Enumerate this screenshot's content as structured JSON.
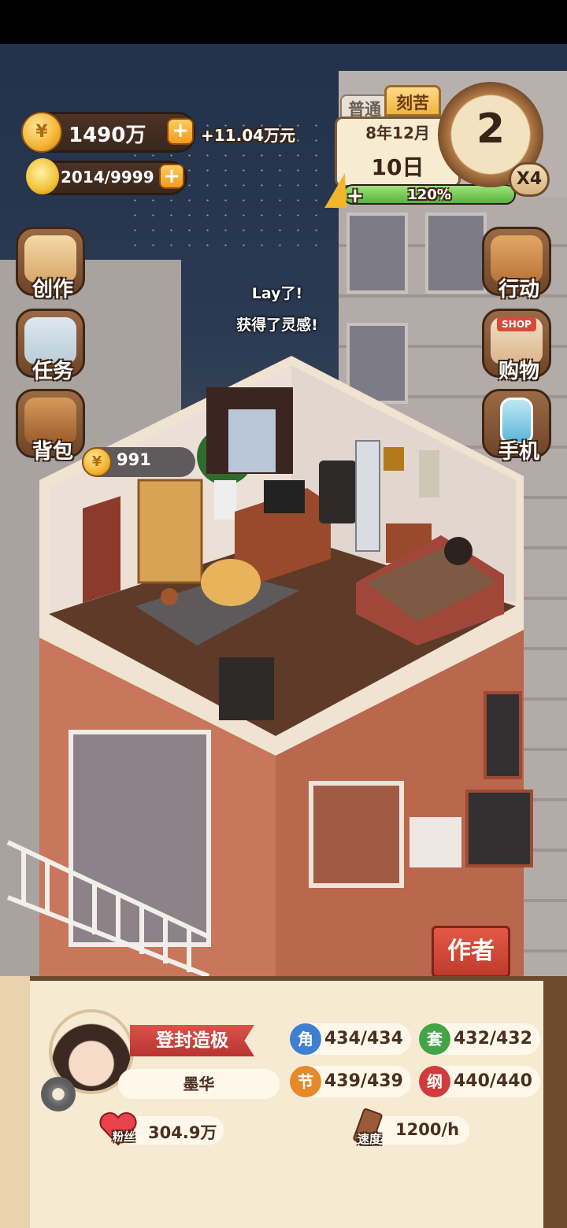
{
  "resources": {
    "coins": "1490万",
    "coin_income": "+11.04万元",
    "inspiration": "2014/9999",
    "inspiration_fraction": 0.2015
  },
  "calendar": {
    "mode_normal": "普通",
    "mode_hard": "刻苦",
    "month": "8年12月",
    "day": "10日",
    "energy_percent_label": "120%",
    "energy_fill": 1.0,
    "clock_value": "2",
    "speed_multiplier": "X4"
  },
  "left_menu": {
    "create": "创作",
    "tasks": "任务",
    "backpack": "背包"
  },
  "right_menu": {
    "action": "行动",
    "shop": "购物",
    "shop_sign": "SHOP",
    "phone": "手机"
  },
  "toast": {
    "line1": "Lay了!",
    "line2": "获得了灵感!"
  },
  "room": {
    "coin_bubble": "991"
  },
  "author_button": "作者",
  "profile": {
    "title": "登封造极",
    "name": "墨华",
    "fans_label": "粉丝",
    "fans_value": "304.9万",
    "speed_label": "速度",
    "speed_value": "1200/h",
    "stats": [
      {
        "icon": "角",
        "value": "434/434",
        "color": "#3f7fd1"
      },
      {
        "icon": "套",
        "value": "432/432",
        "color": "#43a347"
      },
      {
        "icon": "节",
        "value": "439/439",
        "color": "#e5892a"
      },
      {
        "icon": "纲",
        "value": "440/440",
        "color": "#d23b3b"
      }
    ]
  }
}
